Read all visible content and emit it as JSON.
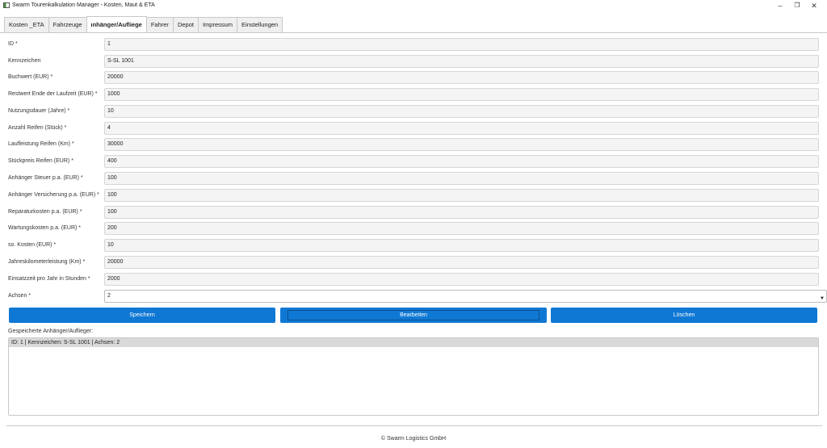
{
  "window": {
    "title": "Swarm Tourenkalkulation Manager - Kosten, Maut & ETA",
    "icon": "app-window-icon",
    "controls": {
      "minimize": "–",
      "maximize": "❐",
      "close": "✕"
    }
  },
  "tabs": [
    {
      "label": "Kosten _ETA",
      "active": false
    },
    {
      "label": "Fahrzeuge",
      "active": false
    },
    {
      "label": "ınhänger/Aufliege",
      "active": true
    },
    {
      "label": "Fahrer",
      "active": false
    },
    {
      "label": "Depot",
      "active": false
    },
    {
      "label": "Impressum",
      "active": false
    },
    {
      "label": "Einstellungen",
      "active": false
    }
  ],
  "form": {
    "fields": [
      {
        "label": "ID *",
        "value": "1"
      },
      {
        "label": "Kennzeichen",
        "value": "S-SL 1001"
      },
      {
        "label": "Buchwert (EUR) *",
        "value": "20000"
      },
      {
        "label": "Restwert Ende der Laufzeit (EUR) *",
        "value": "1000"
      },
      {
        "label": "Nutzungsdauer (Jahre) *",
        "value": "10"
      },
      {
        "label": "Anzahl Reifen (Stück) *",
        "value": "4"
      },
      {
        "label": "Laufleistung Reifen (Km) *",
        "value": "30000"
      },
      {
        "label": "Stückpreis Reifen (EUR) *",
        "value": "400"
      },
      {
        "label": "Anhänger Steuer p.a. (EUR) *",
        "value": "100"
      },
      {
        "label": "Anhänger Versicherung p.a. (EUR) *",
        "value": "100"
      },
      {
        "label": "Reparaturkosten p.a. (EUR) *",
        "value": "100"
      },
      {
        "label": "Wartungskosten p.a. (EUR) *",
        "value": "200"
      },
      {
        "label": "so. Kosten (EUR) *",
        "value": "10"
      },
      {
        "label": "Jahreskilometerleistung (Km) *",
        "value": "20000"
      },
      {
        "label": "Einsatzzeit pro Jahr in Stunden *",
        "value": "2000"
      }
    ],
    "axles": {
      "label": "Achsen *",
      "value": "2",
      "arrow": "▼"
    }
  },
  "buttons": {
    "save": "Speichern",
    "edit": "Bearbeiten",
    "delete": "Löschen"
  },
  "list": {
    "label": "Gespeicherte Anhänger/Auflieger:",
    "items": [
      "ID: 1 | Kennzeichen: S-SL 1001 | Achsen: 2"
    ]
  },
  "footer": {
    "text": "© Swarm Logistics GmbH"
  },
  "colors": {
    "accent": "#0f78d4",
    "input_bg": "#f4f4f4",
    "selected_row": "#d9d9d9"
  }
}
